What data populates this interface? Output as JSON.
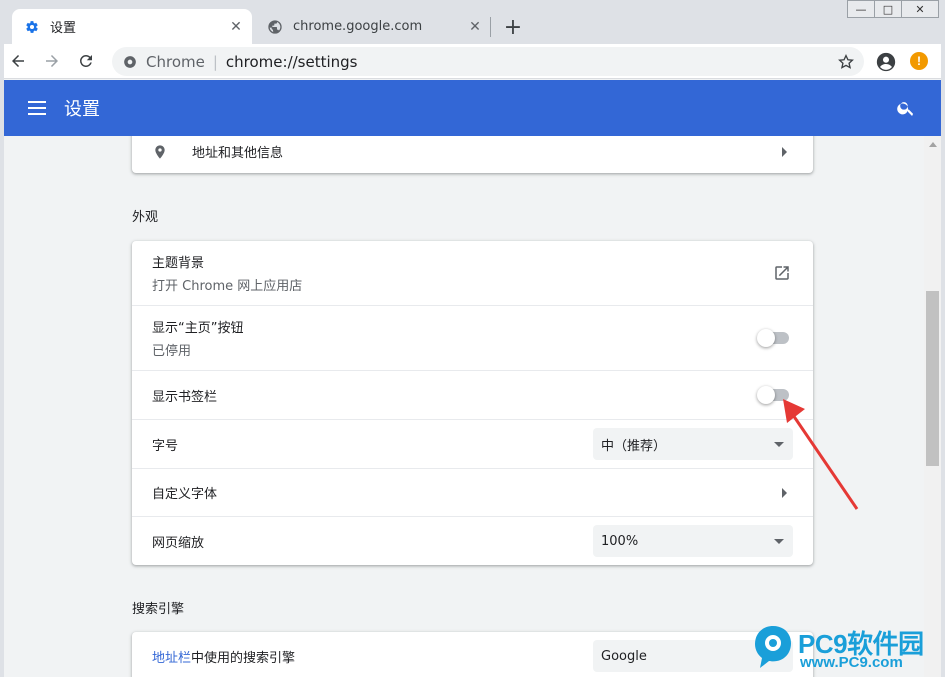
{
  "window": {
    "minimize_label": "—",
    "maximize_label": "□",
    "close_label": "✕"
  },
  "tabs": [
    {
      "title": "设置",
      "icon": "gear-icon",
      "active": true
    },
    {
      "title": "chrome.google.com",
      "icon": "globe-icon",
      "active": false
    }
  ],
  "new_tab_label": "+",
  "tab_close_label": "✕",
  "omnibox": {
    "chip": "Chrome",
    "separator": "|",
    "url": "chrome://settings"
  },
  "alert_label": "!",
  "header": {
    "title": "设置"
  },
  "privacy_card": {
    "addresses_label": "地址和其他信息"
  },
  "appearance": {
    "section_title": "外观",
    "theme_title": "主题背景",
    "theme_subtitle": "打开 Chrome 网上应用店",
    "home_button_title": "显示“主页”按钮",
    "home_button_subtitle": "已停用",
    "home_button_enabled": false,
    "bookmarks_bar_title": "显示书签栏",
    "bookmarks_bar_enabled": false,
    "font_size_title": "字号",
    "font_size_value": "中（推荐）",
    "custom_fonts_title": "自定义字体",
    "page_zoom_title": "网页缩放",
    "page_zoom_value": "100%"
  },
  "search_engine": {
    "section_title": "搜索引擎",
    "row_link": "地址栏",
    "row_text": "中使用的搜索引擎",
    "value": "Google"
  },
  "watermark": {
    "brand": "PC9软件园",
    "url": "www.PC9.com"
  },
  "colors": {
    "header_bg": "#3367d6",
    "accent_link": "#3367d6",
    "annotation_arrow": "#e53935",
    "alert": "#f29900"
  }
}
